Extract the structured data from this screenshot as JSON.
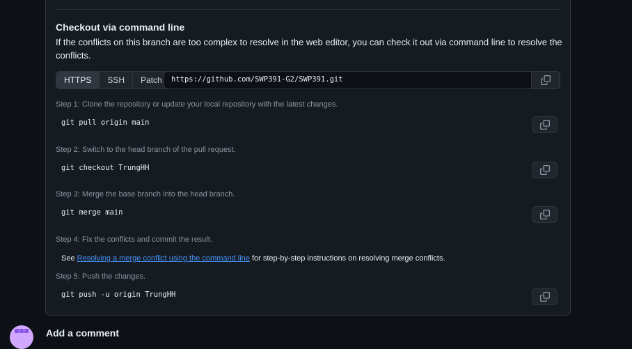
{
  "checkout": {
    "title": "Checkout via command line",
    "description": "If the conflicts on this branch are too complex to resolve in the web editor, you can check it out via command line to resolve the conflicts.",
    "protocols": [
      "HTTPS",
      "SSH",
      "Patch"
    ],
    "selected_protocol": "HTTPS",
    "url": "https://github.com/SWP391-G2/SWP391.git",
    "steps": [
      {
        "label": "Step 1:",
        "text": " Clone the repository or update your local repository with the latest changes.",
        "command": "git pull origin main"
      },
      {
        "label": "Step 2:",
        "text": " Switch to the head branch of the pull request.",
        "command": "git checkout TrungHH"
      },
      {
        "label": "Step 3:",
        "text": " Merge the base branch into the head branch.",
        "command": "git merge main"
      },
      {
        "label": "Step 4:",
        "text": " Fix the conflicts and commit the result.",
        "command": ""
      },
      {
        "label": "Step 5:",
        "text": " Push the changes.",
        "command": "git push -u origin TrungHH"
      }
    ],
    "see_prefix": "See ",
    "see_link": "Resolving a merge conflict using the command line",
    "see_suffix": " for step-by-step instructions on resolving merge conflicts."
  },
  "bottom": {
    "partial_text": "Add a comment"
  },
  "icons": {
    "copy": "copy-icon"
  },
  "colors": {
    "background": "#0d1117",
    "panel": "#161b22",
    "border": "#30363d",
    "link": "#4493f8",
    "muted": "#8b949e"
  }
}
